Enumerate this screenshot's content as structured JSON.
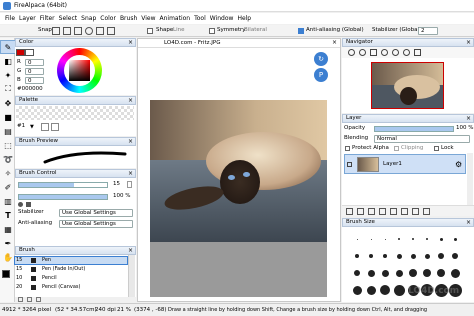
{
  "title": "FireAlpaca (64bit)",
  "menu": [
    "File",
    "Layer",
    "Filter",
    "Select",
    "Snap",
    "Color",
    "Brush",
    "View",
    "Animation",
    "Tool",
    "Window",
    "Help"
  ],
  "toolbar": {
    "snap_label": "Snap",
    "shape_line_label": "Shape",
    "shape_line_value": "Line",
    "symmetry_label": "Symmetry",
    "symmetry_value": "Bilateral",
    "antialias_label": "Anti-aliasing (Global)",
    "stabilizer_label": "Stabilizer (Global)",
    "stabilizer_value": "2"
  },
  "color_panel": {
    "title": "Color",
    "r": "0",
    "g": "0",
    "b": "0",
    "hex": "#000000"
  },
  "palette_panel": {
    "title": "Palette",
    "index": "#1"
  },
  "brush_preview": {
    "title": "Brush Preview"
  },
  "brush_control": {
    "title": "Brush Control",
    "size": "15",
    "opacity": "100 %",
    "stabilizer_label": "Stabilizer",
    "stabilizer_value": "Use Global Settings",
    "antialias_label": "Anti-aliasing",
    "antialias_value": "Use Global Settings"
  },
  "brush_panel": {
    "title": "Brush",
    "items": [
      {
        "size": "15",
        "name": "Pen"
      },
      {
        "size": "15",
        "name": "Pen (Fade In/Out)"
      },
      {
        "size": "10",
        "name": "Pencil"
      },
      {
        "size": "20",
        "name": "Pencil (Canvas)"
      }
    ]
  },
  "canvas": {
    "tab_title": "LO4D.com - Fritz.JPG"
  },
  "navigator": {
    "title": "Navigator"
  },
  "layer_panel": {
    "title": "Layer",
    "opacity_label": "Opacity",
    "opacity_value": "100 %",
    "blending_label": "Blending",
    "blending_value": "Normal",
    "protect_alpha": "Protect Alpha",
    "clipping": "Clipping",
    "lock": "Lock",
    "layer_name": "Layer1"
  },
  "brush_size_panel": {
    "title": "Brush Size"
  },
  "status": {
    "dims": "4912 * 3264 pixel",
    "cm": "(52 * 34.57cm)",
    "dpi": "240 dpi",
    "zoom": "21 %",
    "coords": "(3374 , -68)",
    "hint": "Draw a straight line by holding down Shift, Change a brush size by holding down Ctrl, Alt, and dragging"
  },
  "watermark": "LO4D.com",
  "colors": {
    "accent": "#3c7fd1",
    "selected_row": "#2f6fd6",
    "panel_head": "#dbe5f1"
  }
}
